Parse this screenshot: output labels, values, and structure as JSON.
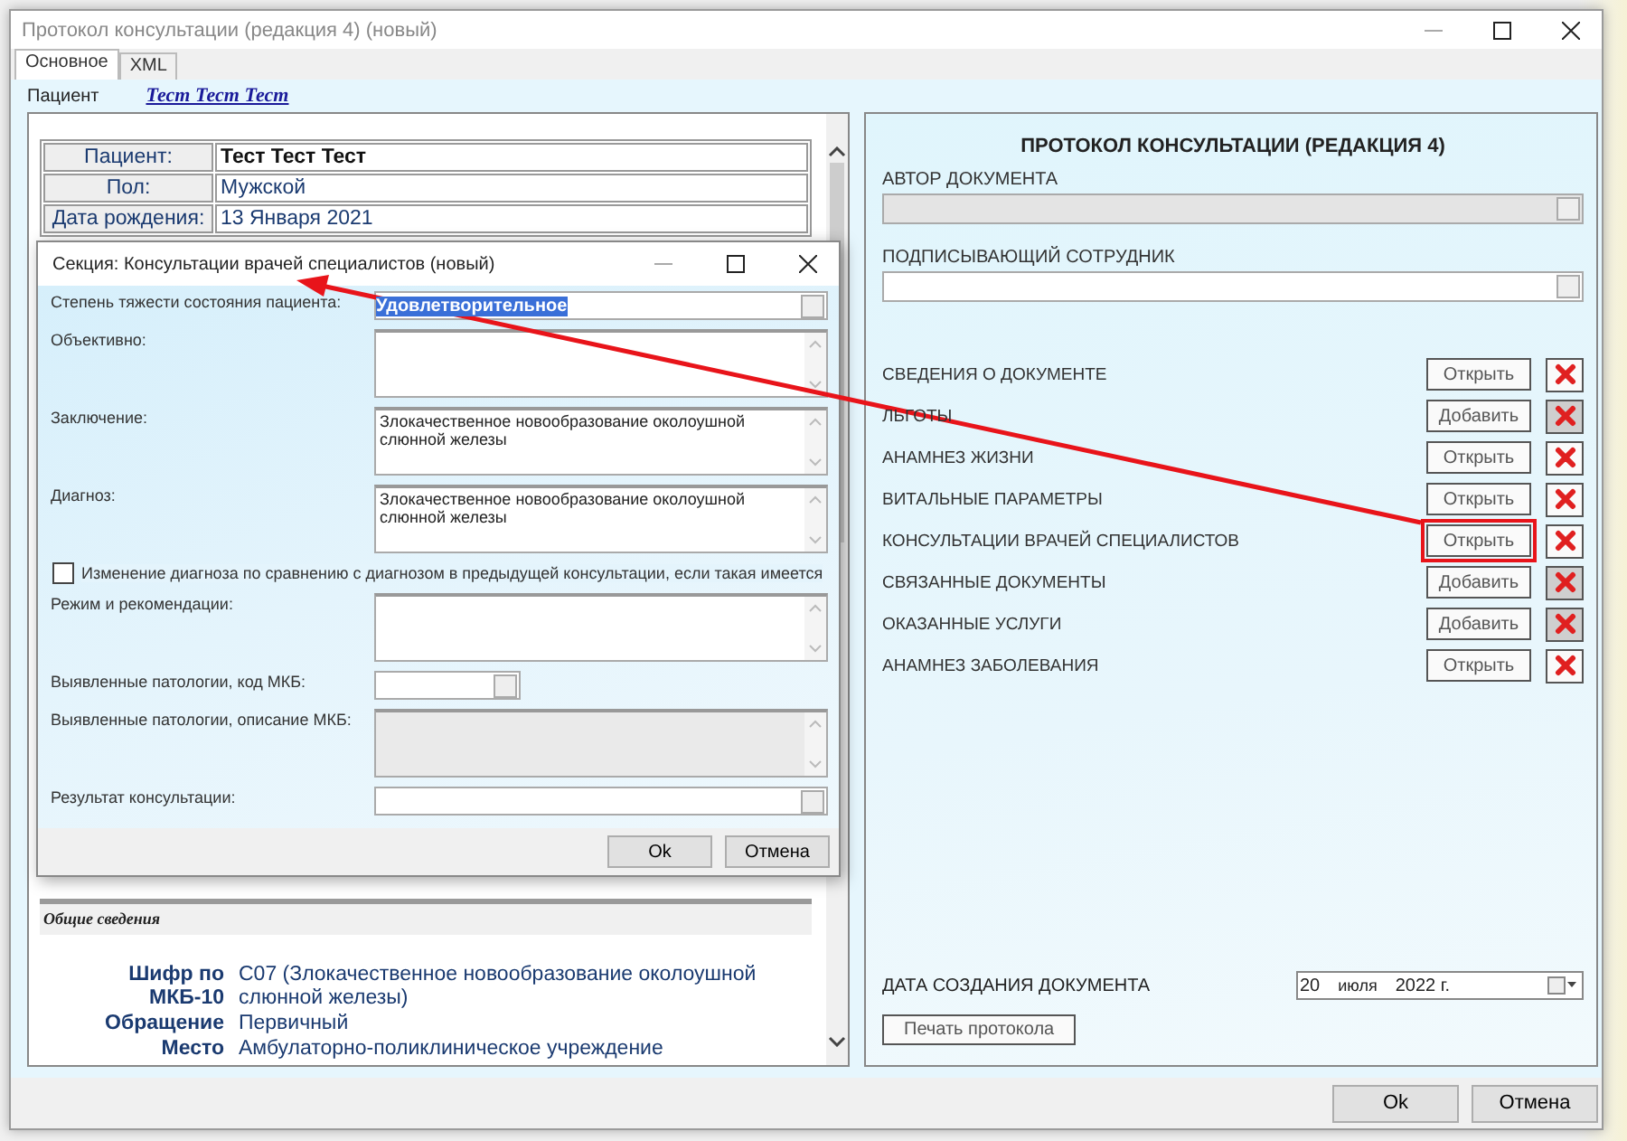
{
  "window": {
    "title": "Протокол консультации (редакция 4) (новый)"
  },
  "tabs": [
    {
      "label": "Основное",
      "selected": true
    },
    {
      "label": "XML",
      "selected": false
    }
  ],
  "patient_bar": {
    "label": "Пациент",
    "value": "Тест Тест Тест"
  },
  "patient_table": [
    {
      "label": "Пациент:",
      "value": "Тест Тест Тест",
      "bold": true
    },
    {
      "label": "Пол:",
      "value": "Мужской",
      "bold": false
    },
    {
      "label": "Дата рождения:",
      "value": "13 Января 2021",
      "bold": false
    }
  ],
  "general_section": {
    "title": "Общие сведения",
    "fields": [
      {
        "label": "Шифр по МКБ-10",
        "value": "C07 (Злокачественное новообразование околоушной слюнной железы)"
      },
      {
        "label": "Обращение",
        "value": "Первичный"
      },
      {
        "label": "Место",
        "value": "Амбулаторно-поликлиническое учреждение"
      }
    ]
  },
  "protocol": {
    "title": "ПРОТОКОЛ КОНСУЛЬТАЦИИ (РЕДАКЦИЯ 4)",
    "author": {
      "label": "АВТОР ДОКУМЕНТА",
      "disabled": true
    },
    "signer": {
      "label": "ПОДПИСЫВАЮЩИЙ СОТРУДНИК",
      "disabled": false
    },
    "sections": [
      {
        "name": "СВЕДЕНИЯ О ДОКУМЕНТЕ",
        "action": "Открыть",
        "delete_disabled": false,
        "highlighted": false
      },
      {
        "name": "ЛЬГОТЫ",
        "action": "Добавить",
        "delete_disabled": true,
        "highlighted": false
      },
      {
        "name": "АНАМНЕЗ ЖИЗНИ",
        "action": "Открыть",
        "delete_disabled": false,
        "highlighted": false
      },
      {
        "name": "ВИТАЛЬНЫЕ ПАРАМЕТРЫ",
        "action": "Открыть",
        "delete_disabled": false,
        "highlighted": false
      },
      {
        "name": "КОНСУЛЬТАЦИИ ВРАЧЕЙ СПЕЦИАЛИСТОВ",
        "action": "Открыть",
        "delete_disabled": false,
        "highlighted": true
      },
      {
        "name": "СВЯЗАННЫЕ ДОКУМЕНТЫ",
        "action": "Добавить",
        "delete_disabled": true,
        "highlighted": false
      },
      {
        "name": "ОКАЗАННЫЕ УСЛУГИ",
        "action": "Добавить",
        "delete_disabled": true,
        "highlighted": false
      },
      {
        "name": "АНАМНЕЗ ЗАБОЛЕВАНИЯ",
        "action": "Открыть",
        "delete_disabled": false,
        "highlighted": false
      }
    ],
    "date": {
      "label": "ДАТА СОЗДАНИЯ ДОКУМЕНТА",
      "day": "20",
      "month": "июля",
      "year": "2022 г."
    },
    "print_button": "Печать протокола"
  },
  "buttons": [
    "Ok",
    "Отмена"
  ],
  "dialog": {
    "title": "Секция: Консультации врачей специалистов (новый)",
    "fields": [
      {
        "kind": "combo",
        "label": "Степень тяжести состояния пациента:",
        "value": "Удовлетворительное",
        "value_selected": true
      },
      {
        "kind": "memo",
        "label": "Объективно:"
      },
      {
        "kind": "memo",
        "label": "Заключение:",
        "value": "Злокачественное новообразование околоушной слюнной железы"
      },
      {
        "kind": "memo",
        "label": "Диагноз:",
        "value": "Злокачественное новообразование околоушной слюнной железы"
      },
      {
        "kind": "checkbox",
        "label": "Изменение диагноза по сравнению с диагнозом в предыдущей консультации, если такая имеется",
        "checked": false
      },
      {
        "kind": "memo",
        "label": "Режим и рекомендации:"
      },
      {
        "kind": "short",
        "label": "Выявленные патологии, код МКБ:"
      },
      {
        "kind": "memo_disabled",
        "label": "Выявленные патологии, описание МКБ:"
      },
      {
        "kind": "combo",
        "label": "Результат консультации:"
      }
    ],
    "buttons": [
      "Ok",
      "Отмена"
    ]
  }
}
